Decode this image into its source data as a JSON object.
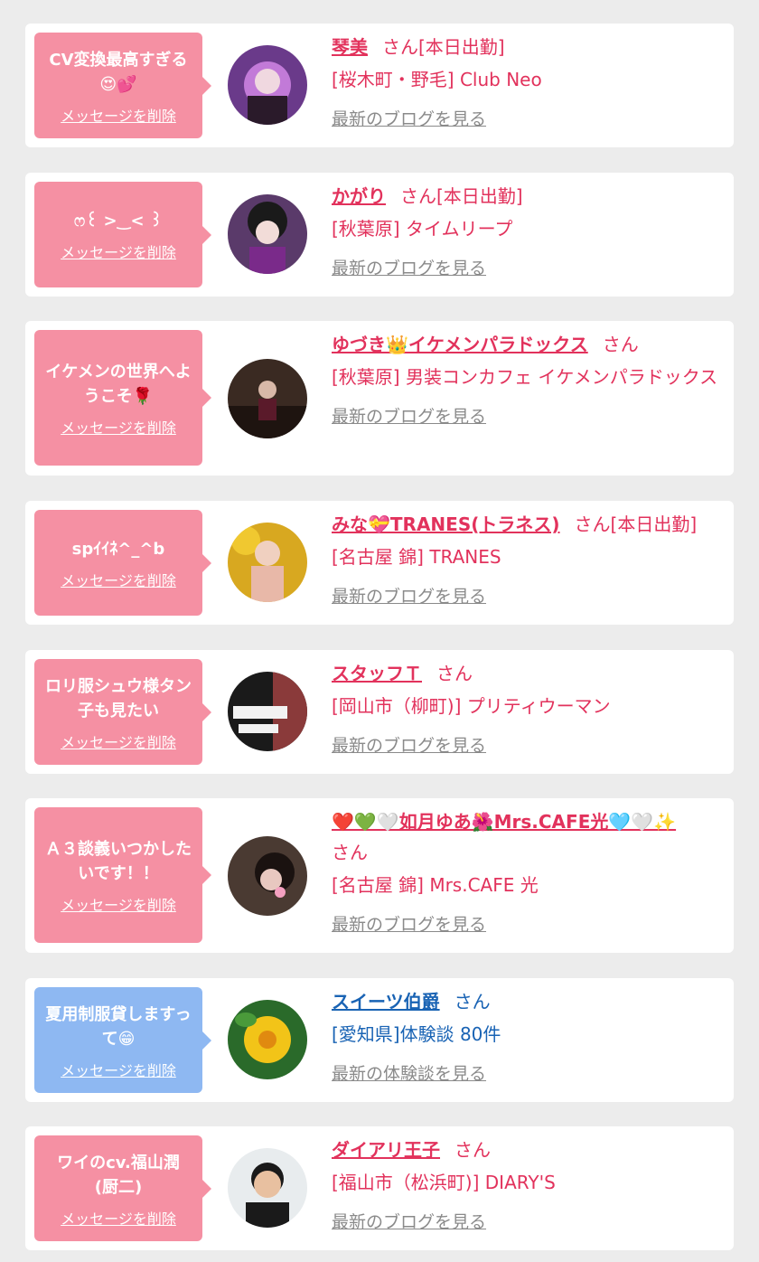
{
  "items": [
    {
      "message": "CV変換最高すぎる\n😍💕",
      "delete_label": "メッセージを削除",
      "name": "琴美",
      "suffix": "さん[本日出勤]",
      "shop": "[桜木町・野毛] Club Neo",
      "link": "最新のブログを見る"
    },
    {
      "message": "ෆ꒰ >‿< ꒱",
      "delete_label": "メッセージを削除",
      "name": "かがり",
      "suffix": "さん[本日出勤]",
      "shop": "[秋葉原] タイムリープ",
      "link": "最新のブログを見る"
    },
    {
      "message": "イケメンの世界へようこそ🌹",
      "delete_label": "メッセージを削除",
      "name": "ゆづき👑イケメンパラドックス",
      "suffix": "さん",
      "shop": "[秋葉原] 男装コンカフェ イケメンパラドックス",
      "link": "最新のブログを見る"
    },
    {
      "message": "spｲｲﾈ^_^b",
      "delete_label": "メッセージを削除",
      "name": "みな💝TRANES(トラネス)",
      "suffix": "さん[本日出勤]",
      "shop": "[名古屋 錦] TRANES",
      "link": "最新のブログを見る"
    },
    {
      "message": "ロリ服シュウ様タン子も見たい",
      "delete_label": "メッセージを削除",
      "name": "スタッフＴ",
      "suffix": "さん",
      "shop": "[岡山市（柳町)] プリティウーマン",
      "link": "最新のブログを見る"
    },
    {
      "message": "Ａ３談義いつかしたいです！！",
      "delete_label": "メッセージを削除",
      "name": "❤️💚🤍如月ゆあ🌺Mrs.CAFE光🩵🤍✨",
      "suffix": "さん",
      "shop": "[名古屋 錦] Mrs.CAFE 光",
      "link": "最新のブログを見る"
    },
    {
      "message": "夏用制服貸しますって😁",
      "delete_label": "メッセージを削除",
      "name": "スイーツ伯爵",
      "suffix": "さん",
      "shop": "[愛知県]体験談 80件",
      "link": "最新の体験談を見る"
    },
    {
      "message": "ワイのcv.福山潤\n(厨二)",
      "delete_label": "メッセージを削除",
      "name": "ダイアリ王子",
      "suffix": "さん",
      "shop": "[福山市（松浜町)] DIARY'S",
      "link": "最新のブログを見る"
    }
  ],
  "colors": {
    "accent_pink": "#e2325c",
    "accent_blue": "#1963b4",
    "bubble_pink": "#f590a3",
    "bubble_blue": "#8eb8f2"
  }
}
